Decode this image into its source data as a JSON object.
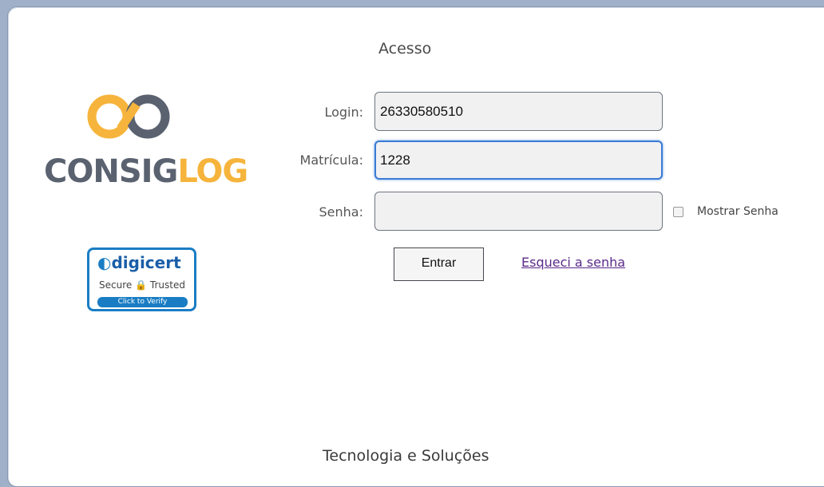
{
  "page": {
    "heading": "Acesso",
    "footer": "Tecnologia e Soluções"
  },
  "logo": {
    "part1": "CONSIG",
    "part2": "LOG",
    "colors": {
      "gray": "#5a6270",
      "orange": "#f6b43c"
    }
  },
  "badge": {
    "brand": "digicert",
    "secure": "Secure",
    "trusted": "Trusted",
    "verify": "Click to Verify"
  },
  "form": {
    "login_label": "Login:",
    "login_value": "26330580510",
    "matricula_label": "Matrícula:",
    "matricula_value": "1228",
    "senha_label": "Senha:",
    "senha_value": "",
    "show_password_label": "Mostrar Senha",
    "show_password_checked": false,
    "submit_label": "Entrar",
    "forgot_label": "Esqueci a senha"
  }
}
